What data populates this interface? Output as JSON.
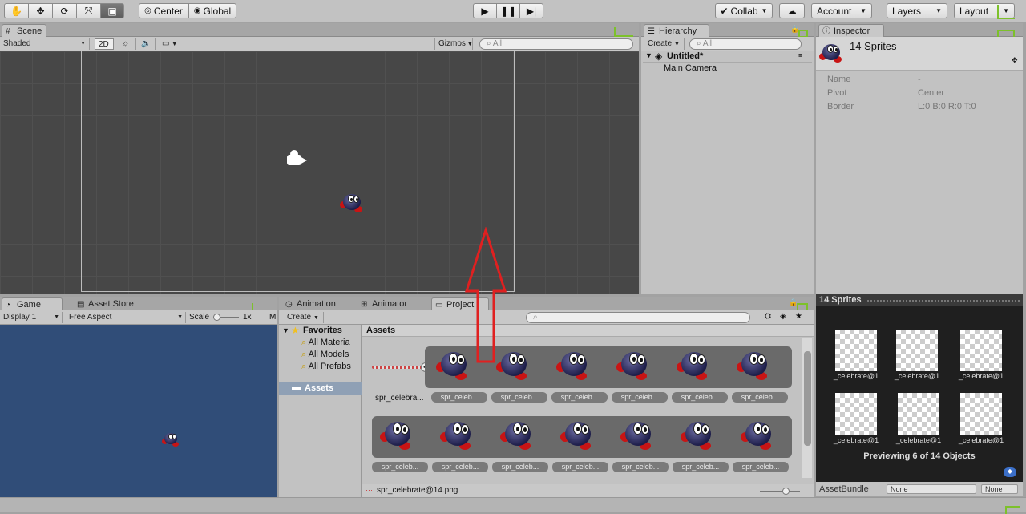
{
  "toolbar": {
    "pivot": "Center",
    "space": "Global",
    "collab": "Collab",
    "account": "Account",
    "layers": "Layers",
    "layout": "Layout"
  },
  "scene": {
    "tab": "Scene",
    "shading": "Shaded",
    "mode2d": "2D",
    "gizmos": "Gizmos",
    "search_placeholder": "All"
  },
  "hierarchy": {
    "tab": "Hierarchy",
    "create": "Create",
    "search_placeholder": "All",
    "scene_name": "Untitled*",
    "items": [
      "Main Camera"
    ]
  },
  "inspector": {
    "tab": "Inspector",
    "title": "14 Sprites",
    "fields": [
      {
        "label": "Name",
        "value": "-"
      },
      {
        "label": "Pivot",
        "value": "Center"
      },
      {
        "label": "Border",
        "value": "L:0 B:0 R:0 T:0"
      }
    ],
    "preview_header": "14 Sprites",
    "preview_labels": [
      "_celebrate@1",
      "_celebrate@1",
      "_celebrate@1",
      "_celebrate@1",
      "_celebrate@1",
      "_celebrate@1"
    ],
    "preview_caption": "Previewing 6 of 14 Objects",
    "assetbundle_label": "AssetBundle",
    "assetbundle_value": "None",
    "assetbundle_variant": "None"
  },
  "game": {
    "tab": "Game",
    "asset_store_tab": "Asset Store",
    "display": "Display 1",
    "aspect": "Free Aspect",
    "scale_label": "Scale",
    "scale_value": "1x",
    "extra": "M"
  },
  "project": {
    "tabs": [
      "Animation",
      "Animator",
      "Project"
    ],
    "create": "Create",
    "favorites_label": "Favorites",
    "favorites": [
      "All Materia",
      "All Models",
      "All Prefabs"
    ],
    "assets_folder": "Assets",
    "breadcrumb": "Assets",
    "parent_label": "spr_celebra...",
    "row1_labels": [
      "spr_celeb...",
      "spr_celeb...",
      "spr_celeb...",
      "spr_celeb...",
      "spr_celeb...",
      "spr_celeb..."
    ],
    "row2_labels": [
      "spr_celeb...",
      "spr_celeb...",
      "spr_celeb...",
      "spr_celeb...",
      "spr_celeb...",
      "spr_celeb...",
      "spr_celeb..."
    ],
    "selected_file": "spr_celebrate@14.png"
  },
  "colors": {
    "scene_bg": "#474747",
    "game_bg": "#304d78",
    "annotation_arrow": "#e02020",
    "layout_marker": "#7dc12b"
  }
}
